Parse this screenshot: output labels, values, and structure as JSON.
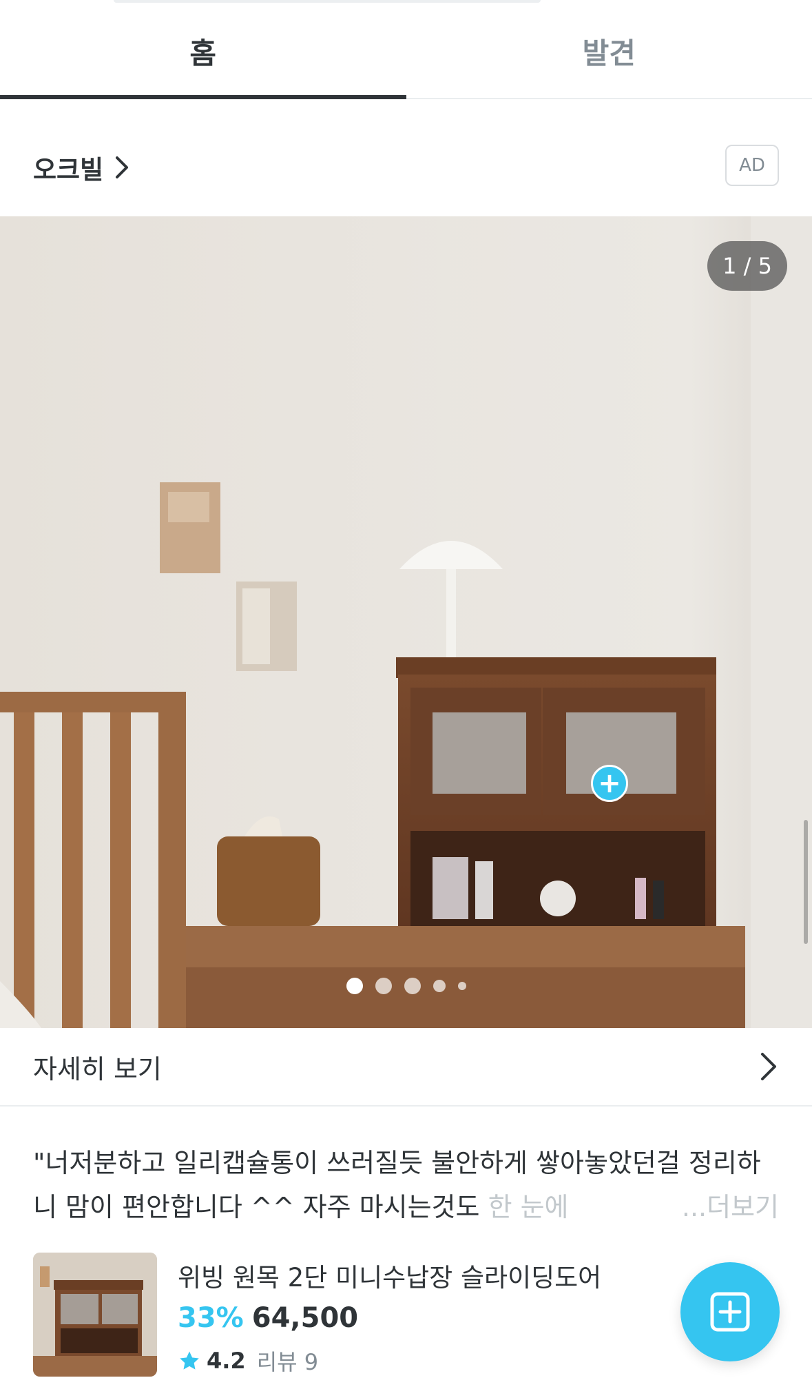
{
  "tabs": [
    {
      "label": "홈",
      "active": true
    },
    {
      "label": "발견",
      "active": false
    }
  ],
  "brand": {
    "name": "오크빌",
    "ad_label": "AD"
  },
  "photo": {
    "counter": "1 / 5",
    "current_index": 1,
    "total": 5,
    "hotspot_icon": "plus-icon"
  },
  "details": {
    "label": "자세히 보기"
  },
  "description": {
    "text": "\"너저분하고 일리캡슐통이 쓰러질듯 불안하게 쌓아놓았던걸 정리하니 맘이 편안합니다 ^^  자주 마시는것도 ",
    "faded": "한 눈에",
    "more_label": "...더보기"
  },
  "product": {
    "name": "위빙 원목 2단 미니수납장 슬라이딩도어",
    "discount": "33%",
    "price": "64,500",
    "rating": "4.2",
    "review_label": "리뷰 9"
  },
  "colors": {
    "accent": "#35c5f0",
    "text": "#2f3438",
    "muted": "#828c94"
  }
}
